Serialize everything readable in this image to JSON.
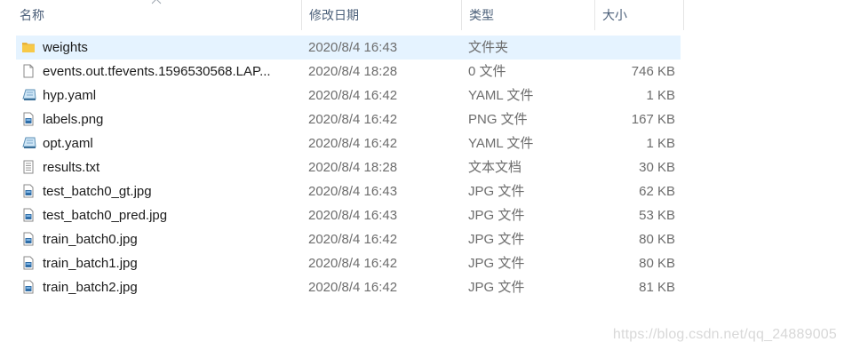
{
  "columns": {
    "name": "名称",
    "date": "修改日期",
    "type": "类型",
    "size": "大小"
  },
  "files": [
    {
      "name": "weights",
      "date": "2020/8/4 16:43",
      "type": "文件夹",
      "size": "",
      "icon": "folder-icon",
      "selected": true
    },
    {
      "name": "events.out.tfevents.1596530568.LAP...",
      "date": "2020/8/4 18:28",
      "type": "0 文件",
      "size": "746 KB",
      "icon": "blank-file-icon"
    },
    {
      "name": "hyp.yaml",
      "date": "2020/8/4 16:42",
      "type": "YAML 文件",
      "size": "1 KB",
      "icon": "yaml-file-icon"
    },
    {
      "name": "labels.png",
      "date": "2020/8/4 16:42",
      "type": "PNG 文件",
      "size": "167 KB",
      "icon": "image-file-icon"
    },
    {
      "name": "opt.yaml",
      "date": "2020/8/4 16:42",
      "type": "YAML 文件",
      "size": "1 KB",
      "icon": "yaml-file-icon"
    },
    {
      "name": "results.txt",
      "date": "2020/8/4 18:28",
      "type": "文本文档",
      "size": "30 KB",
      "icon": "text-file-icon"
    },
    {
      "name": "test_batch0_gt.jpg",
      "date": "2020/8/4 16:43",
      "type": "JPG 文件",
      "size": "62 KB",
      "icon": "image-file-icon"
    },
    {
      "name": "test_batch0_pred.jpg",
      "date": "2020/8/4 16:43",
      "type": "JPG 文件",
      "size": "53 KB",
      "icon": "image-file-icon"
    },
    {
      "name": "train_batch0.jpg",
      "date": "2020/8/4 16:42",
      "type": "JPG 文件",
      "size": "80 KB",
      "icon": "image-file-icon"
    },
    {
      "name": "train_batch1.jpg",
      "date": "2020/8/4 16:42",
      "type": "JPG 文件",
      "size": "80 KB",
      "icon": "image-file-icon"
    },
    {
      "name": "train_batch2.jpg",
      "date": "2020/8/4 16:42",
      "type": "JPG 文件",
      "size": "81 KB",
      "icon": "image-file-icon"
    }
  ],
  "watermark": "https://blog.csdn.net/qq_24889005",
  "colors": {
    "header_text": "#4c607a",
    "selection": "#e5f3ff",
    "folder": "#e8b23a"
  }
}
